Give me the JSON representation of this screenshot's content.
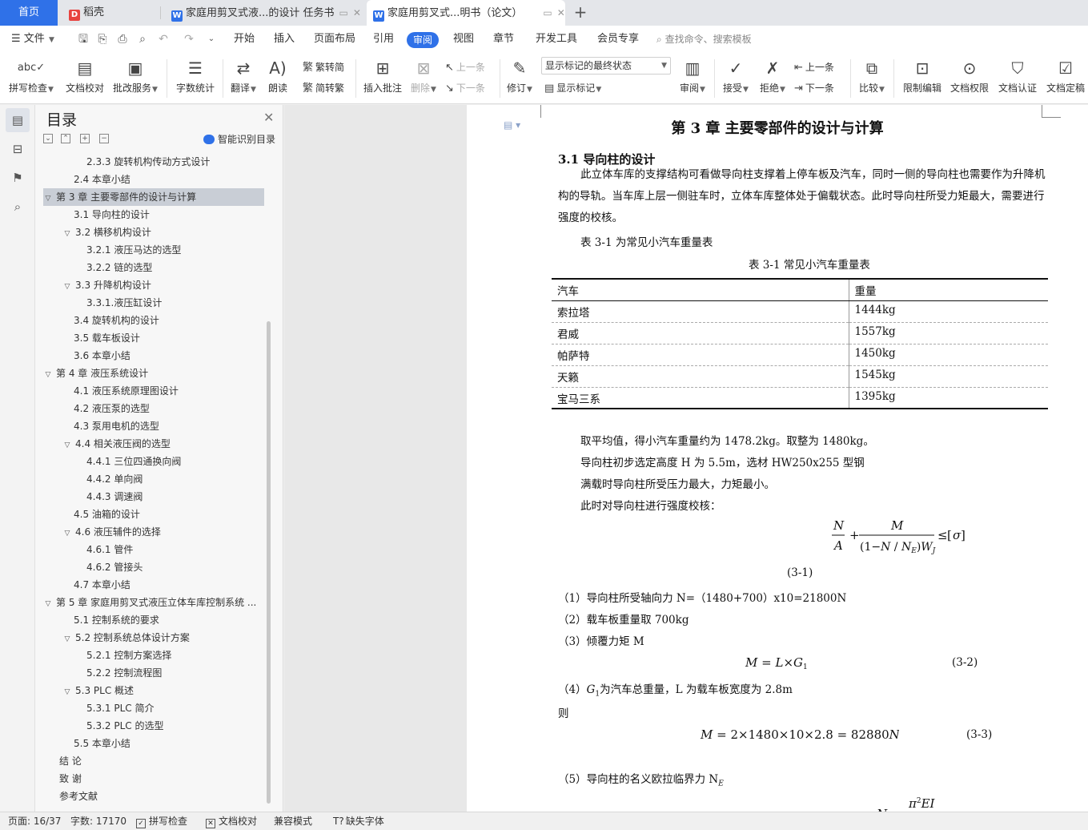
{
  "tabs": {
    "home": "首页",
    "items": [
      {
        "label": "稻壳",
        "icon": "daoke-icon"
      },
      {
        "label": "家庭用剪叉式液...的设计 任务书",
        "icon": "wps-writer-icon"
      },
      {
        "label": "家庭用剪叉式...明书（论文）",
        "icon": "wps-writer-icon"
      }
    ]
  },
  "menubar": {
    "file": "文件",
    "items": [
      "开始",
      "插入",
      "页面布局",
      "引用",
      "审阅",
      "视图",
      "章节",
      "开发工具",
      "会员专享"
    ],
    "active": "审阅",
    "search_placeholder": "查找命令、搜索模板"
  },
  "ribbon": {
    "spell_check": "拼写检查",
    "doc_proof": "文档校对",
    "batch_service": "批改服务",
    "word_count": "字数统计",
    "translate": "翻译",
    "read_aloud": "朗读",
    "trad_to_simp": "繁转简",
    "simp_to_trad": "简转繁",
    "insert_comment": "插入批注",
    "delete": "删除",
    "prev_comment": "上一条",
    "next_comment": "下一条",
    "revise": "修订",
    "markup_mode": "显示标记的最终状态",
    "show_markup": "显示标记",
    "review": "审阅",
    "accept": "接受",
    "reject": "拒绝",
    "prev_change": "上一条",
    "next_change": "下一条",
    "compare": "比较",
    "restrict_edit": "限制编辑",
    "doc_permission": "文档权限",
    "doc_cert": "文档认证",
    "doc_finalize": "文档定稿"
  },
  "toc": {
    "title": "目录",
    "smart": "智能识别目录",
    "items": [
      {
        "label": "2.3.3 旋转机构传动方式设计",
        "level": 3,
        "toggle": ""
      },
      {
        "label": "2.4 本章小结",
        "level": 2,
        "toggle": ""
      },
      {
        "label": "第 3 章  主要零部件的设计与计算",
        "level": 1,
        "toggle": "▽",
        "selected": true
      },
      {
        "label": "3.1 导向柱的设计",
        "level": 2,
        "toggle": ""
      },
      {
        "label": "3.2 横移机构设计",
        "level": 2,
        "toggle": "▽"
      },
      {
        "label": "3.2.1 液压马达的选型",
        "level": 3,
        "toggle": ""
      },
      {
        "label": "3.2.2 链的选型",
        "level": 3,
        "toggle": ""
      },
      {
        "label": "3.3 升降机构设计",
        "level": 2,
        "toggle": "▽"
      },
      {
        "label": "3.3.1.液压缸设计",
        "level": 3,
        "toggle": ""
      },
      {
        "label": "3.4 旋转机构的设计",
        "level": 2,
        "toggle": ""
      },
      {
        "label": "3.5  载车板设计",
        "level": 2,
        "toggle": ""
      },
      {
        "label": "3.6 本章小结",
        "level": 2,
        "toggle": ""
      },
      {
        "label": "第 4 章  液压系统设计",
        "level": 1,
        "toggle": "▽"
      },
      {
        "label": "4.1 液压系统原理图设计",
        "level": 2,
        "toggle": ""
      },
      {
        "label": "4.2 液压泵的选型",
        "level": 2,
        "toggle": ""
      },
      {
        "label": "4.3 泵用电机的选型",
        "level": 2,
        "toggle": ""
      },
      {
        "label": "4.4 相关液压阀的选型",
        "level": 2,
        "toggle": "▽"
      },
      {
        "label": "4.4.1 三位四通换向阀",
        "level": 3,
        "toggle": ""
      },
      {
        "label": "4.4.2 单向阀",
        "level": 3,
        "toggle": ""
      },
      {
        "label": "4.4.3 调速阀",
        "level": 3,
        "toggle": ""
      },
      {
        "label": "4.5 油箱的设计",
        "level": 2,
        "toggle": ""
      },
      {
        "label": "4.6 液压辅件的选择",
        "level": 2,
        "toggle": "▽"
      },
      {
        "label": "4.6.1 管件",
        "level": 3,
        "toggle": ""
      },
      {
        "label": "4.6.2 管接头",
        "level": 3,
        "toggle": ""
      },
      {
        "label": "4.7 本章小结",
        "level": 2,
        "toggle": ""
      },
      {
        "label": "第 5 章  家庭用剪叉式液压立体车库控制系统 ...",
        "level": 1,
        "toggle": "▽"
      },
      {
        "label": "5.1 控制系统的要求",
        "level": 2,
        "toggle": ""
      },
      {
        "label": "5.2 控制系统总体设计方案",
        "level": 2,
        "toggle": "▽"
      },
      {
        "label": "5.2.1 控制方案选择",
        "level": 3,
        "toggle": ""
      },
      {
        "label": "5.2.2 控制流程图",
        "level": 3,
        "toggle": ""
      },
      {
        "label": "5.3 PLC 概述",
        "level": 2,
        "toggle": "▽"
      },
      {
        "label": "5.3.1 PLC 简介",
        "level": 3,
        "toggle": ""
      },
      {
        "label": "5.3.2 PLC 的选型",
        "level": 3,
        "toggle": ""
      },
      {
        "label": "5.5  本章小结",
        "level": 2,
        "toggle": ""
      },
      {
        "label": "结    论",
        "level": 1,
        "toggle": ""
      },
      {
        "label": "致    谢",
        "level": 1,
        "toggle": ""
      },
      {
        "label": "参考文献",
        "level": 1,
        "toggle": ""
      }
    ]
  },
  "document": {
    "chapter_title": "第 3 章  主要零部件的设计与计算",
    "section_title": "3.1 导向柱的设计",
    "intro": "此立体车库的支撑结构可看做导向柱支撑着上停车板及汽车，同时一侧的导向柱也需要作为升降机构的导轨。当车库上层一侧驻车时，立体车库整体处于偏载状态。此时导向柱所受力矩最大，需要进行强度的校核。",
    "table_ref": "表 3-1 为常见小汽车重量表",
    "table_caption": "表 3-1 常见小汽车重量表",
    "table": {
      "headers": [
        "汽车",
        "重量"
      ],
      "rows": [
        [
          "索拉塔",
          "1444kg"
        ],
        [
          "君威",
          "1557kg"
        ],
        [
          "帕萨特",
          "1450kg"
        ],
        [
          "天籁",
          "1545kg"
        ],
        [
          "宝马三系",
          "1395kg"
        ]
      ]
    },
    "avg_line": "取平均值，得小汽车重量约为 1478.2kg。取整为 1480kg。",
    "height_line": "导向柱初步选定高度 H 为 5.5m，选材 HW250x255 型钢",
    "max_line": "满载时导向柱所受压力最大，力矩最小。",
    "check_line": "此时对导向柱进行强度校核：",
    "f1_num": "(3-1)",
    "item1": "（1）导向柱所受轴向力 N=（1480+700）x10=21800N",
    "item2": "（2）载车板重量取 700kg",
    "item3": "（3）倾覆力矩 M",
    "f2_num": "(3-2)",
    "item4_sym": "G",
    "item4_sub": "1",
    "item4_text": "为汽车总重量，L 为载车板宽度为 2.8m",
    "item4_prefix": "（4）",
    "then": "则",
    "f3_num": "(3-3)",
    "item5": "（5）导向柱的名义欧拉临界力 N",
    "item5_sub": "E"
  },
  "statusbar": {
    "page": "页面: 16/37",
    "words": "字数: 17170",
    "spell": "拼写检查",
    "proof": "文档校对",
    "compat": "兼容模式",
    "missing_font": "缺失字体"
  },
  "colors": {
    "accent": "#2f71e8",
    "toc_selected": "#c9ced6"
  }
}
